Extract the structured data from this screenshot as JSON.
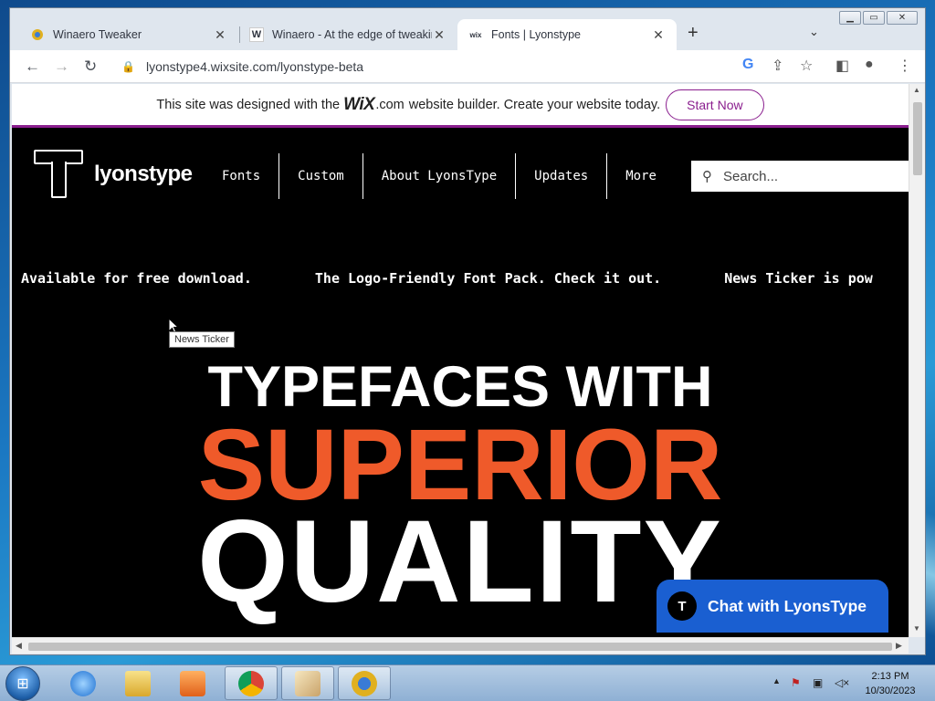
{
  "browser": {
    "tabs": [
      {
        "title": "Winaero Tweaker",
        "active": false
      },
      {
        "title": "Winaero - At the edge of tweaking",
        "active": false
      },
      {
        "title": "Fonts | Lyonstype",
        "active": true
      }
    ],
    "url": "lyonstype4.wixsite.com/lyonstype-beta"
  },
  "wixbar": {
    "text_before": "This site was designed with the",
    "logo": "WiX",
    "domain": ".com",
    "text_after": "website builder. Create your website today.",
    "button": "Start Now"
  },
  "site": {
    "logo_text": "lyonstype",
    "nav": [
      "Fonts",
      "Custom",
      "About LyonsType",
      "Updates",
      "More"
    ],
    "search_placeholder": "Search...",
    "ticker": [
      "Available for free download.",
      "The Logo-Friendly Font Pack. Check it out.",
      "News Ticker is pow"
    ],
    "tooltip": "News Ticker",
    "hero": {
      "line1": "TYPEFACES WITH",
      "line2": "SUPERIOR",
      "line3": "QUALITY"
    },
    "chat": {
      "avatar": "T",
      "label": "Chat with LyonsType"
    },
    "colors": {
      "accent": "#ef5a2a",
      "wix_purple": "#8a1e8e",
      "chat_blue": "#1a5fd1"
    }
  },
  "taskbar": {
    "time": "2:13 PM",
    "date": "10/30/2023"
  }
}
